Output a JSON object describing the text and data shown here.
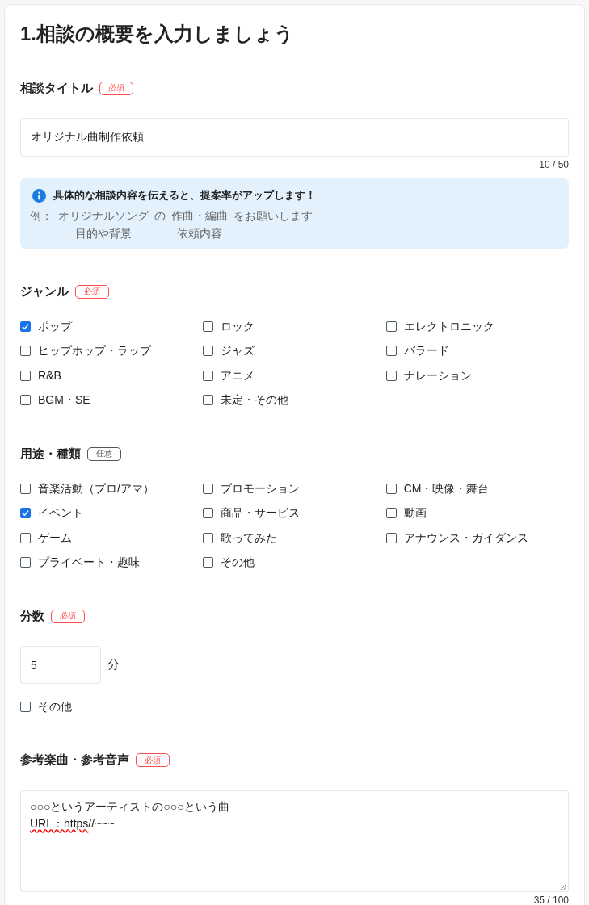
{
  "title": "1.相談の概要を入力しましょう",
  "sections": [
    {
      "kind": "text_input",
      "label": "相談タイトル",
      "badge": {
        "text": "必須",
        "kind": "required"
      },
      "value": "オリジナル曲制作依頼",
      "counter": "10 / 50",
      "tip": {
        "heading": "具体的な相談内容を伝えると、提案率がアップします！",
        "prefix": "例：",
        "parts": [
          {
            "kind": "blank",
            "text": "オリジナルソング",
            "caption": "目的や背景"
          },
          {
            "kind": "text",
            "text": "の"
          },
          {
            "kind": "blank",
            "text": "作曲・編曲",
            "caption": "依頼内容"
          },
          {
            "kind": "text",
            "text": "をお願いします"
          }
        ]
      }
    },
    {
      "kind": "checkboxes",
      "label": "ジャンル",
      "badge": {
        "text": "必須",
        "kind": "required"
      },
      "options": [
        {
          "label": "ポップ",
          "checked": true
        },
        {
          "label": "ロック",
          "checked": false
        },
        {
          "label": "エレクトロニック",
          "checked": false
        },
        {
          "label": "ヒップホップ・ラップ",
          "checked": false
        },
        {
          "label": "ジャズ",
          "checked": false
        },
        {
          "label": "バラード",
          "checked": false
        },
        {
          "label": "R&B",
          "checked": false
        },
        {
          "label": "アニメ",
          "checked": false
        },
        {
          "label": "ナレーション",
          "checked": false
        },
        {
          "label": "BGM・SE",
          "checked": false
        },
        {
          "label": "未定・その他",
          "checked": false
        }
      ]
    },
    {
      "kind": "checkboxes",
      "label": "用途・種類",
      "badge": {
        "text": "任意",
        "kind": "optional"
      },
      "options": [
        {
          "label": "音楽活動（プロ/アマ）",
          "checked": false
        },
        {
          "label": "プロモーション",
          "checked": false
        },
        {
          "label": "CM・映像・舞台",
          "checked": false
        },
        {
          "label": "イベント",
          "checked": true
        },
        {
          "label": "商品・サービス",
          "checked": false
        },
        {
          "label": "動画",
          "checked": false
        },
        {
          "label": "ゲーム",
          "checked": false
        },
        {
          "label": "歌ってみた",
          "checked": false
        },
        {
          "label": "アナウンス・ガイダンス",
          "checked": false
        },
        {
          "label": "プライベート・趣味",
          "checked": false
        },
        {
          "label": "その他",
          "checked": false
        }
      ]
    },
    {
      "kind": "number_input",
      "label": "分数",
      "badge": {
        "text": "必須",
        "kind": "required"
      },
      "value": "5",
      "unit": "分",
      "options": [
        {
          "label": "その他",
          "checked": false
        }
      ]
    },
    {
      "kind": "textarea",
      "label": "参考楽曲・参考音声",
      "badge": {
        "text": "必須",
        "kind": "required"
      },
      "lines": [
        [
          {
            "text": "○○○というアーティストの○○○という曲",
            "misspelled": false
          }
        ],
        [
          {
            "text": "URL：https",
            "misspelled": true
          },
          {
            "text": "//~~~",
            "misspelled": false
          }
        ]
      ],
      "counter": "35 / 100"
    }
  ]
}
